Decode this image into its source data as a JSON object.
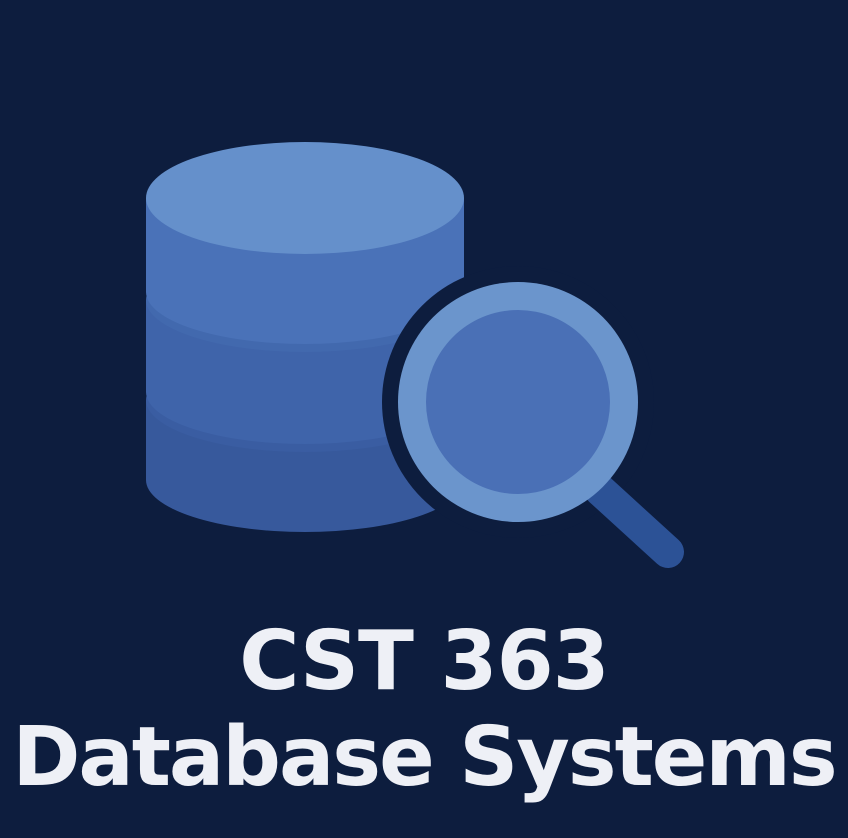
{
  "title": {
    "line1": "CST 363",
    "line2": "Database Systems"
  },
  "icons": {
    "database": "database-cylinder-icon",
    "search": "magnifying-glass-icon"
  },
  "colors": {
    "background": "#0d1d3e",
    "text": "#eef0f6",
    "database_top": "#6590cb",
    "database_tier1": "#4a72b8",
    "database_tier2": "#3f64aa",
    "database_tier3": "#37599c",
    "magnifier_ring": "#6b95cc",
    "magnifier_lens": "#4a70b6",
    "magnifier_handle": "#2c5296"
  }
}
